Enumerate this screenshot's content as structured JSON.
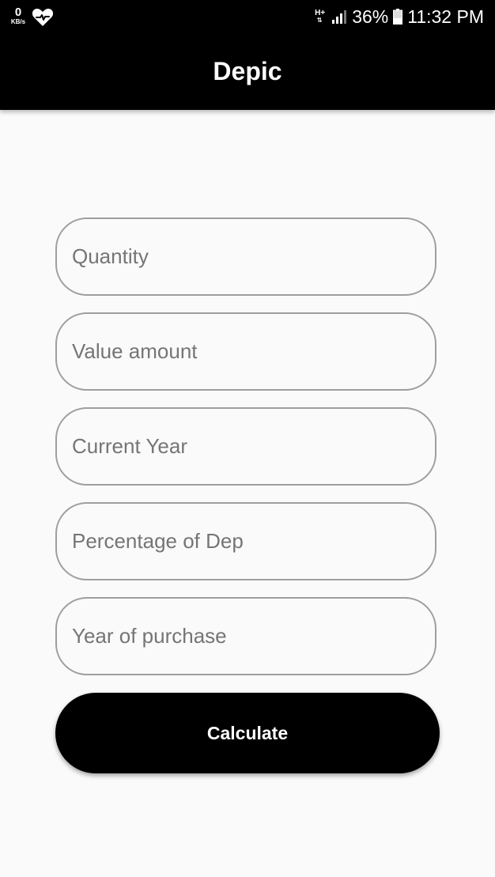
{
  "status_bar": {
    "net_speed_value": "0",
    "net_speed_unit": "KB/s",
    "left_icon": "heart-check-icon",
    "network_type": "H+",
    "network_arrows": "⇅",
    "battery_percent": "36%",
    "time": "11:32 PM"
  },
  "app_bar": {
    "title": "Depic"
  },
  "form": {
    "fields": [
      {
        "placeholder": "Quantity",
        "value": ""
      },
      {
        "placeholder": "Value amount",
        "value": ""
      },
      {
        "placeholder": "Current Year",
        "value": ""
      },
      {
        "placeholder": "Percentage of Dep",
        "value": ""
      },
      {
        "placeholder": "Year of purchase",
        "value": ""
      }
    ],
    "calculate_label": "Calculate"
  },
  "colors": {
    "app_bar": "#000000",
    "background": "#fafafa",
    "field_border": "#9e9e9e",
    "placeholder": "#757575",
    "button": "#000000",
    "button_text": "#ffffff"
  }
}
